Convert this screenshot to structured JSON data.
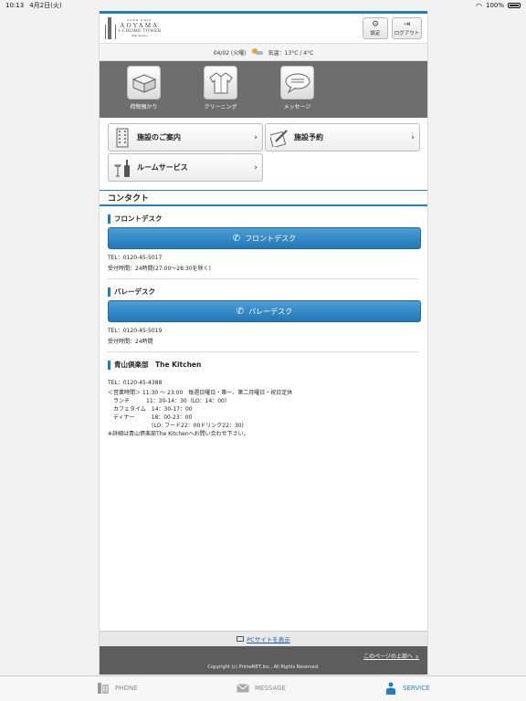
{
  "status_bar": {
    "time": "10:13",
    "date": "4月2日(火)",
    "battery": "100%"
  },
  "header": {
    "logo": {
      "line1": "PARK AXIS",
      "line2": "AOYAMA",
      "line3": "1-CHOME TOWER",
      "line4": "Web Service"
    },
    "settings_label": "設定",
    "logout_label": "ログアウト"
  },
  "weather": {
    "date": "04/02 (火曜)",
    "temperature": "気温：13°C / 4°C"
  },
  "tiles": [
    {
      "label": "荷物預かり"
    },
    {
      "label": "クリーニング"
    },
    {
      "label": "メッセージ"
    }
  ],
  "menu": [
    {
      "label": "施設のご案内"
    },
    {
      "label": "施設予約"
    },
    {
      "label": "ルームサービス"
    }
  ],
  "contact": {
    "title": "コンタクト",
    "front": {
      "heading": "フロントデスク",
      "button": "フロントデスク",
      "tel": "TEL：0120-45-5017",
      "hours": "受付時間：24時間(27:00〜28:30を除く)"
    },
    "valet": {
      "heading": "バレーデスク",
      "button": "バレーデスク",
      "tel": "TEL：0120-45-5019",
      "hours": "受付時間：24時間"
    },
    "kitchen": {
      "heading": "青山倶楽部　The Kitchen",
      "tel": "TEL：0120-45-4388",
      "l1": "＜営業時間＞ 11:30 〜 23:00　毎週日曜日・第一、第二月曜日・祝日定休",
      "l2": "　ランチ　　　11：30-14：30（LO：14：00）",
      "l3": "　カフェタイム　14：30-17：00",
      "l4": "　ディナー　　　18：00-23：00",
      "l5": "　　　　　　　　(LO: フード22：00ドリンク22：30)",
      "l6": "※詳細は青山倶楽部The Kitchenへお問い合わせ下さい。"
    }
  },
  "footer": {
    "pc_link": "PCサイトを表示",
    "to_top": "このページの上部へ ⌅",
    "copyright": "Copyright (c) PrimeNET,Inc., All Rights Reserved."
  },
  "tabbar": [
    {
      "label": "PHONE"
    },
    {
      "label": "MESSAGE"
    },
    {
      "label": "SERVICE"
    }
  ],
  "colors": {
    "accent": "#1f7fbf",
    "panel_gray": "#6e6e6e",
    "footer_gray": "#5d5d5d"
  }
}
